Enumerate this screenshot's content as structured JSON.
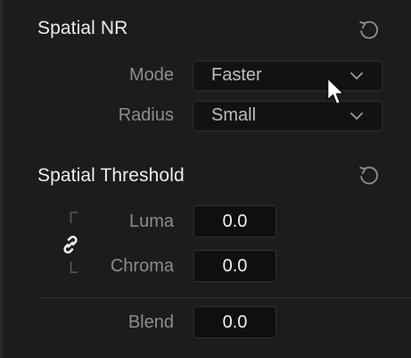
{
  "spatial_nr": {
    "title": "Spatial NR",
    "reset_icon": "reset-icon",
    "mode": {
      "label": "Mode",
      "value": "Faster"
    },
    "radius": {
      "label": "Radius",
      "value": "Small"
    }
  },
  "spatial_threshold": {
    "title": "Spatial Threshold",
    "reset_icon": "reset-icon",
    "link_icon": "link-icon",
    "luma": {
      "label": "Luma",
      "value": "0.0"
    },
    "chroma": {
      "label": "Chroma",
      "value": "0.0"
    },
    "blend": {
      "label": "Blend",
      "value": "0.0"
    }
  },
  "colors": {
    "panel_bg": "#1c1c1e",
    "field_bg": "#121213",
    "label": "#8c8c8c",
    "title": "#eeeeee"
  }
}
